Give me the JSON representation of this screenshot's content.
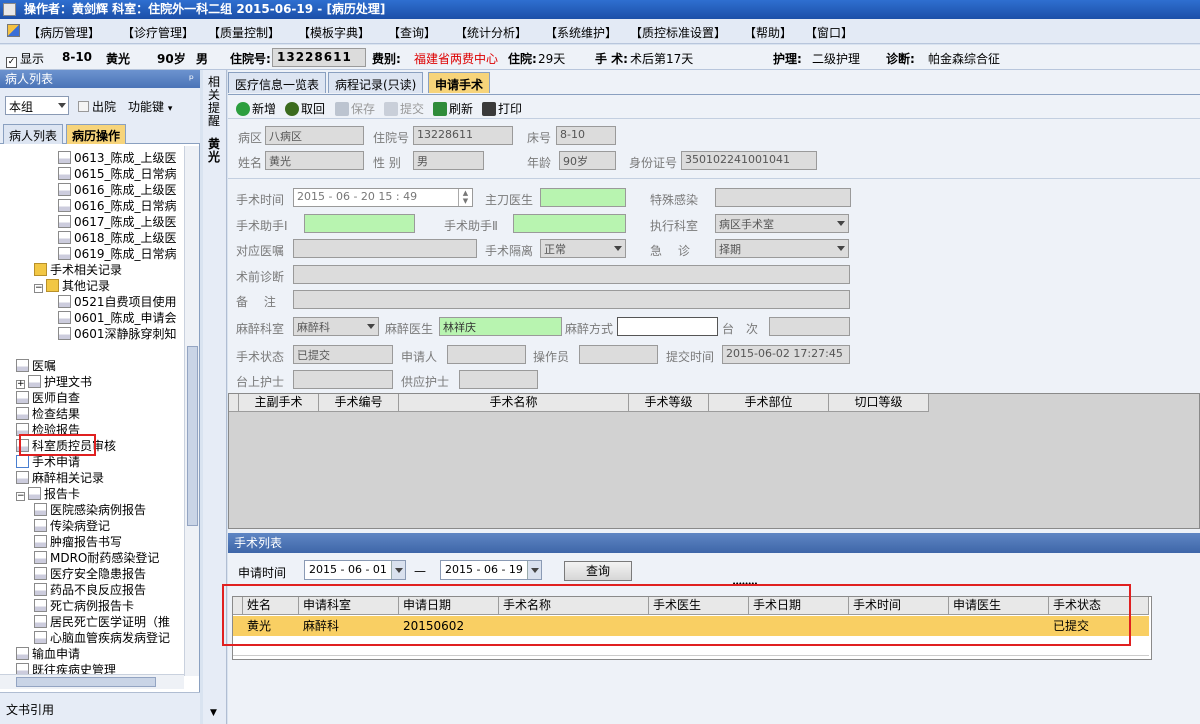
{
  "titlebar": {
    "text": "操作者：黄剑辉   科室：住院外一科二组   2015-06-19 - [病历处理]"
  },
  "menu": [
    "【病历管理】",
    "【诊疗管理】",
    "【质量控制】",
    "【模板字典】",
    "【查询】",
    "【统计分析】",
    "【系统维护】",
    "【质控标准设置】",
    "【帮助】",
    "【窗口】"
  ],
  "info": {
    "display_label": "显示",
    "bed": "8-10",
    "name": "黄光",
    "age": "90岁",
    "sex": "男",
    "inpatient_no_label": "住院号:",
    "inpatient_no": "13228611",
    "fee_type_label": "费别:",
    "fee_type": "福建省两费中心",
    "stay_label": "住院:",
    "stay": "29天",
    "surgery_label": "手 术:",
    "surgery": "术后第17天",
    "nursing_label": "护理:",
    "nursing": "二级护理",
    "diagnosis_label": "诊断:",
    "diagnosis": "帕金森综合征"
  },
  "left": {
    "title": "病人列表",
    "pin": "ᵖ",
    "group": "本组",
    "discharge_label": "出院",
    "function_key": "功能键",
    "tabs": [
      "病人列表",
      "病历操作"
    ],
    "tree": [
      {
        "label": "0613_陈成_上级医",
        "indent": 3,
        "icon": "doc"
      },
      {
        "label": "0615_陈成_日常病",
        "indent": 3,
        "icon": "doc"
      },
      {
        "label": "0616_陈成_上级医",
        "indent": 3,
        "icon": "doc"
      },
      {
        "label": "0616_陈成_日常病",
        "indent": 3,
        "icon": "doc"
      },
      {
        "label": "0617_陈成_上级医",
        "indent": 3,
        "icon": "doc"
      },
      {
        "label": "0618_陈成_上级医",
        "indent": 3,
        "icon": "doc"
      },
      {
        "label": "0619_陈成_日常病",
        "indent": 3,
        "icon": "doc"
      },
      {
        "label": "手术相关记录",
        "indent": 2,
        "icon": "folder"
      },
      {
        "label": "其他记录",
        "indent": 2,
        "icon": "folder",
        "expander": "−"
      },
      {
        "label": "0521自费项目使用",
        "indent": 3,
        "icon": "doc"
      },
      {
        "label": "0601_陈成_申请会",
        "indent": 3,
        "icon": "doc"
      },
      {
        "label": "0601深静脉穿刺知",
        "indent": 3,
        "icon": "doc"
      },
      {
        "label": "",
        "indent": 1,
        "icon": ""
      },
      {
        "label": "医嘱",
        "indent": 1,
        "icon": "doc"
      },
      {
        "label": "护理文书",
        "indent": 1,
        "icon": "doc",
        "expander": "+"
      },
      {
        "label": "医师自查",
        "indent": 1,
        "icon": "doc"
      },
      {
        "label": "检查结果",
        "indent": 1,
        "icon": "doc"
      },
      {
        "label": "检验报告",
        "indent": 1,
        "icon": "doc"
      },
      {
        "label": "科室质控员审核",
        "indent": 1,
        "icon": "doc"
      },
      {
        "label": "手术申请",
        "indent": 1,
        "icon": "check"
      },
      {
        "label": "麻醉相关记录",
        "indent": 1,
        "icon": "doc"
      },
      {
        "label": "报告卡",
        "indent": 1,
        "icon": "doc",
        "expander": "−"
      },
      {
        "label": "医院感染病例报告",
        "indent": 2,
        "icon": "doc"
      },
      {
        "label": "传染病登记",
        "indent": 2,
        "icon": "doc"
      },
      {
        "label": "肿瘤报告书写",
        "indent": 2,
        "icon": "doc"
      },
      {
        "label": "MDRO耐药感染登记",
        "indent": 2,
        "icon": "doc"
      },
      {
        "label": "医疗安全隐患报告",
        "indent": 2,
        "icon": "doc"
      },
      {
        "label": "药品不良反应报告",
        "indent": 2,
        "icon": "doc"
      },
      {
        "label": "死亡病例报告卡",
        "indent": 2,
        "icon": "doc"
      },
      {
        "label": "居民死亡医学证明（推",
        "indent": 2,
        "icon": "doc"
      },
      {
        "label": "心脑血管疾病发病登记",
        "indent": 2,
        "icon": "doc"
      },
      {
        "label": "输血申请",
        "indent": 1,
        "icon": "doc"
      },
      {
        "label": "既往疾病史管理",
        "indent": 1,
        "icon": "doc"
      },
      {
        "label": "病人综合浏览",
        "indent": 1,
        "icon": "doc"
      }
    ],
    "footer": "文书引用"
  },
  "sidetab": {
    "a": "相关提醒",
    "b": "黄光"
  },
  "tabs": [
    "医疗信息一览表",
    "病程记录(只读)",
    "申请手术"
  ],
  "toolbar": [
    "新增",
    "取回",
    "保存",
    "提交",
    "刷新",
    "打印"
  ],
  "patient": {
    "ward_label": "病区",
    "ward": "八病区",
    "inno_label": "住院号",
    "inno": "13228611",
    "bed_label": "床号",
    "bed": "8-10",
    "name_label": "姓名",
    "name": "黄光",
    "sex_label": "性 别",
    "sex": "男",
    "age_label": "年龄",
    "age": "90岁",
    "id_label": "身份证号",
    "id": "350102241001041"
  },
  "surgery": {
    "time_label": "手术时间",
    "time": "2015 - 06 - 20   15 : 49",
    "chief_label": "主刀医生",
    "chief": "",
    "special_label": "特殊感染",
    "special": "",
    "asst1_label": "手术助手Ⅰ",
    "asst1": "",
    "asst2_label": "手术助手Ⅱ",
    "asst2": "",
    "dept_label": "执行科室",
    "dept": "病区手术室",
    "order_label": "对应医嘱",
    "order": "",
    "isolation_label": "手术隔离",
    "isolation": "正常",
    "emergency_label": "急　 诊",
    "emergency": "择期",
    "preop_label": "术前诊断",
    "preop": "",
    "note_label": "备　 注",
    "note": "",
    "anes_dept_label": "麻醉科室",
    "anes_dept": "麻醉科",
    "anes_doc_label": "麻醉医生",
    "anes_doc": "林祥庆",
    "anes_method_label": "麻醉方式",
    "anes_method": "",
    "table_no_label": "台　次",
    "table_no": "",
    "status_label": "手术状态",
    "status": "已提交",
    "applicant_label": "申请人",
    "applicant": "",
    "operator_label": "操作员",
    "operator": "",
    "submit_time_label": "提交时间",
    "submit_time": "2015-06-02 17:27:45",
    "nurse_on_label": "台上护士",
    "nurse_on": "",
    "nurse_sup_label": "供应护士",
    "nurse_sup": ""
  },
  "surgery_grid_headers": [
    "主副手术",
    "手术编号",
    "手术名称",
    "手术等级",
    "手术部位",
    "切口等级"
  ],
  "list": {
    "title": "手术列表",
    "apply_time_label": "申请时间",
    "from": "2015 - 06 - 01",
    "dash": "—",
    "to": "2015 - 06 - 19",
    "query_button": "查询",
    "splitter": "••••••••",
    "headers": [
      "姓名",
      "申请科室",
      "申请日期",
      "手术名称",
      "手术医生",
      "手术日期",
      "手术时间",
      "申请医生",
      "手术状态"
    ],
    "rows": [
      [
        "黄光",
        "麻醉科",
        "20150602",
        "",
        "",
        "",
        "",
        "",
        "已提交"
      ]
    ]
  },
  "colors": {
    "highlight_row": "#f9cf63",
    "green_field": "#b8f4b0",
    "title_bar": "#2f6fd0"
  }
}
